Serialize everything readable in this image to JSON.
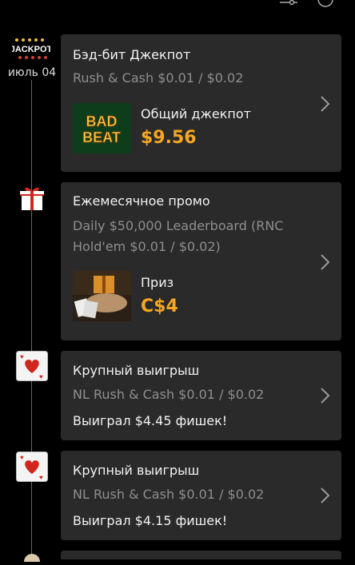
{
  "header": {
    "filter_icon": "sliders-icon",
    "refresh_icon": "refresh-icon"
  },
  "timeline": {
    "jackpot_badge": "JACKPOT",
    "date": "июль 04"
  },
  "cards": [
    {
      "title": "Бэд-бит Джекпот",
      "subtitle": "Rush & Cash $0.01 / $0.02",
      "thumb_text_1": "BAD",
      "thumb_text_2": "BEAT",
      "label": "Общий джекпот",
      "amount": "$9.56"
    },
    {
      "title": "Ежемесячное промо",
      "subtitle_line1": "Daily $50,000 Leaderboard (RNC",
      "subtitle_line2": "Hold'em $0.01 / $0.02)",
      "label": "Приз",
      "amount": "C$4"
    },
    {
      "title": "Крупный выигрыш",
      "subtitle": "NL Rush & Cash $0.01 / $0.02",
      "win_text": "Выиграл $4.45 фишек!"
    },
    {
      "title": "Крупный выигрыш",
      "subtitle": "NL Rush & Cash $0.01 / $0.02",
      "win_text": "Выиграл $4.15 фишек!"
    }
  ],
  "colors": {
    "accent": "#f5a623",
    "card_bg": "#2a2a2a",
    "muted": "#8e8e8e"
  }
}
